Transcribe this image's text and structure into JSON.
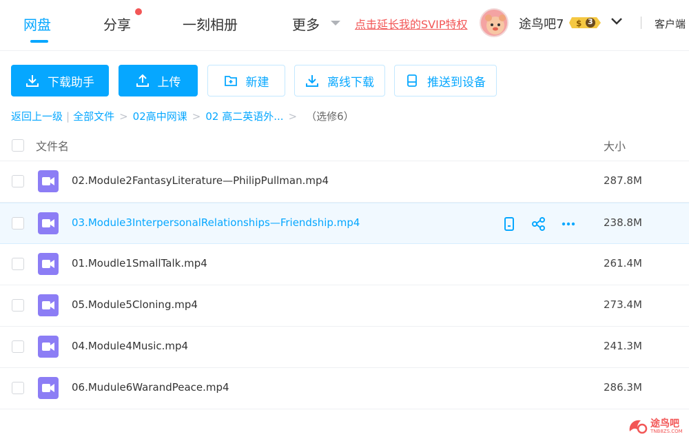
{
  "nav": {
    "tabs": [
      {
        "label": "网盘"
      },
      {
        "label": "分享"
      },
      {
        "label": "一刻相册"
      },
      {
        "label": "更多"
      }
    ],
    "promo_link": "点击延长我的SVIP特权",
    "username": "途鸟吧7",
    "svip_level": "3",
    "client_link": "客户端"
  },
  "toolbar": {
    "download_helper": "下载助手",
    "upload": "上传",
    "new": "新建",
    "offline_download": "离线下载",
    "push_to_device": "推送到设备"
  },
  "breadcrumb": {
    "back": "返回上一级",
    "items": [
      "全部文件",
      "02高中网课",
      "02 高二英语外..."
    ],
    "current": "（选修6）"
  },
  "table": {
    "col_name": "文件名",
    "col_size": "大小",
    "rows": [
      {
        "name": "02.Module2FantasyLiterature—PhilipPullman.mp4",
        "size": "287.8M"
      },
      {
        "name": "03.Module3InterpersonalRelationships—Friendship.mp4",
        "size": "238.8M"
      },
      {
        "name": "01.Moudle1SmallTalk.mp4",
        "size": "261.4M"
      },
      {
        "name": "05.Module5Cloning.mp4",
        "size": "273.4M"
      },
      {
        "name": "04.Module4Music.mp4",
        "size": "241.3M"
      },
      {
        "name": "06.Mudule6WarandPeace.mp4",
        "size": "286.3M"
      }
    ]
  },
  "watermark": {
    "text": "途鸟吧",
    "sub": "TNB8ZS.COM"
  },
  "colors": {
    "accent": "#06a7ff",
    "promo": "#f25656",
    "video_icon": "#8c7df5"
  }
}
